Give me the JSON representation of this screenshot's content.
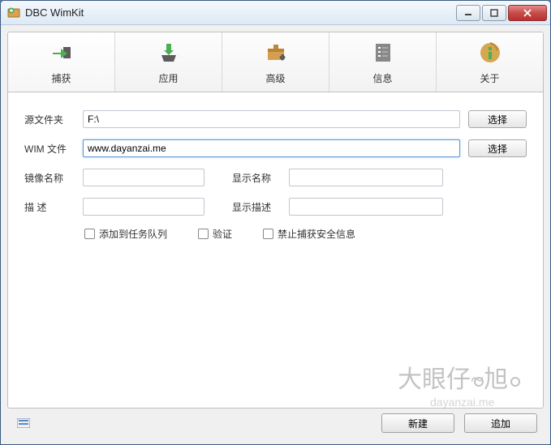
{
  "window": {
    "title": "DBC WimKit"
  },
  "toolbar": {
    "capture": "捕获",
    "apply": "应用",
    "advanced": "高级",
    "info": "信息",
    "about": "关于"
  },
  "form": {
    "source_folder_label": "源文件夹",
    "source_folder_value": "F:\\",
    "wim_file_label": "WIM 文件",
    "wim_file_value": "www.dayanzai.me",
    "image_name_label": "镜像名称",
    "image_name_value": "",
    "display_name_label": "显示名称",
    "display_name_value": "",
    "description_label": "描   述",
    "description_value": "",
    "display_desc_label": "显示描述",
    "display_desc_value": "",
    "select_button": "选择"
  },
  "checkboxes": {
    "add_to_queue": "添加到任务队列",
    "verify": "验证",
    "forbid_security": "禁止捕获安全信息"
  },
  "footer": {
    "new_button": "新建",
    "append_button": "追加"
  },
  "watermark": {
    "text": "大眼仔~旭",
    "url": "dayanzai.me"
  }
}
